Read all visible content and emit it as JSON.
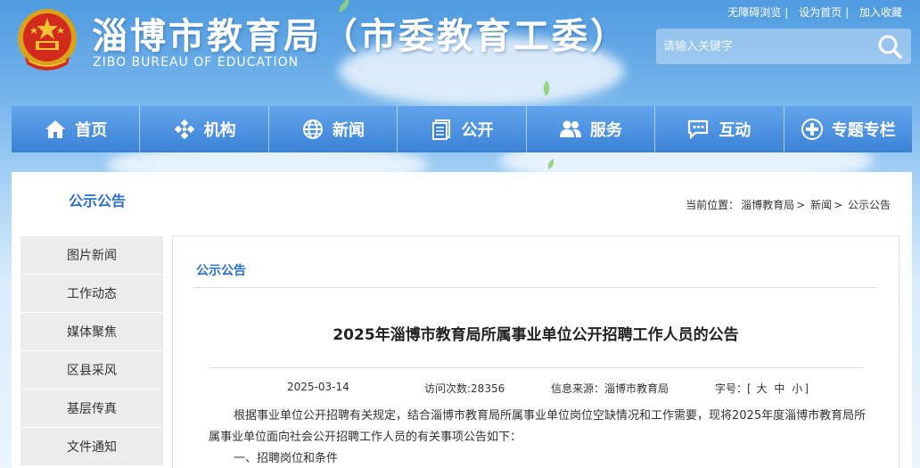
{
  "header": {
    "title": "淄博市教育局（市委教育工委）",
    "subtitle": "ZIBO BUREAU OF EDUCATION",
    "toplinks": [
      "无障碍浏览",
      "设为首页",
      "加入收藏"
    ],
    "search_placeholder": "请输入关键字"
  },
  "nav": [
    {
      "label": "首页",
      "icon": "home-icon"
    },
    {
      "label": "机构",
      "icon": "structure-icon"
    },
    {
      "label": "新闻",
      "icon": "globe-icon"
    },
    {
      "label": "公开",
      "icon": "document-icon"
    },
    {
      "label": "服务",
      "icon": "users-icon"
    },
    {
      "label": "互动",
      "icon": "chat-icon"
    },
    {
      "label": "专题专栏",
      "icon": "column-icon"
    }
  ],
  "sidebar": {
    "title": "公示公告",
    "items": [
      "图片新闻",
      "工作动态",
      "媒体聚焦",
      "区县采风",
      "基层传真",
      "文件通知"
    ]
  },
  "breadcrumb": {
    "prefix": "当前位置：",
    "path": [
      "淄博教育局",
      "新闻",
      "公示公告"
    ],
    "separator": ">"
  },
  "article": {
    "section": "公示公告",
    "title": "2025年淄博市教育局所属事业单位公开招聘工作人员的公告",
    "date": "2025-03-14",
    "visits": "访问次数:28356",
    "source": "信息来源：淄博市教育局",
    "font_size_label": "字号：",
    "font_sizes": [
      "大",
      "中",
      "小"
    ],
    "paragraph1": "根据事业单位公开招聘有关规定，结合淄博市教育局所属事业单位岗位空缺情况和工作需要，现将2025年度淄博市教育局所属事业单位面向社会公开招聘工作人员的有关事项公告如下：",
    "paragraph2": "一、招聘岗位和条件"
  },
  "colors": {
    "nav_blue": "#3b82d6",
    "accent_blue": "#2a6fc9",
    "sky_top": "#4f9be0"
  }
}
